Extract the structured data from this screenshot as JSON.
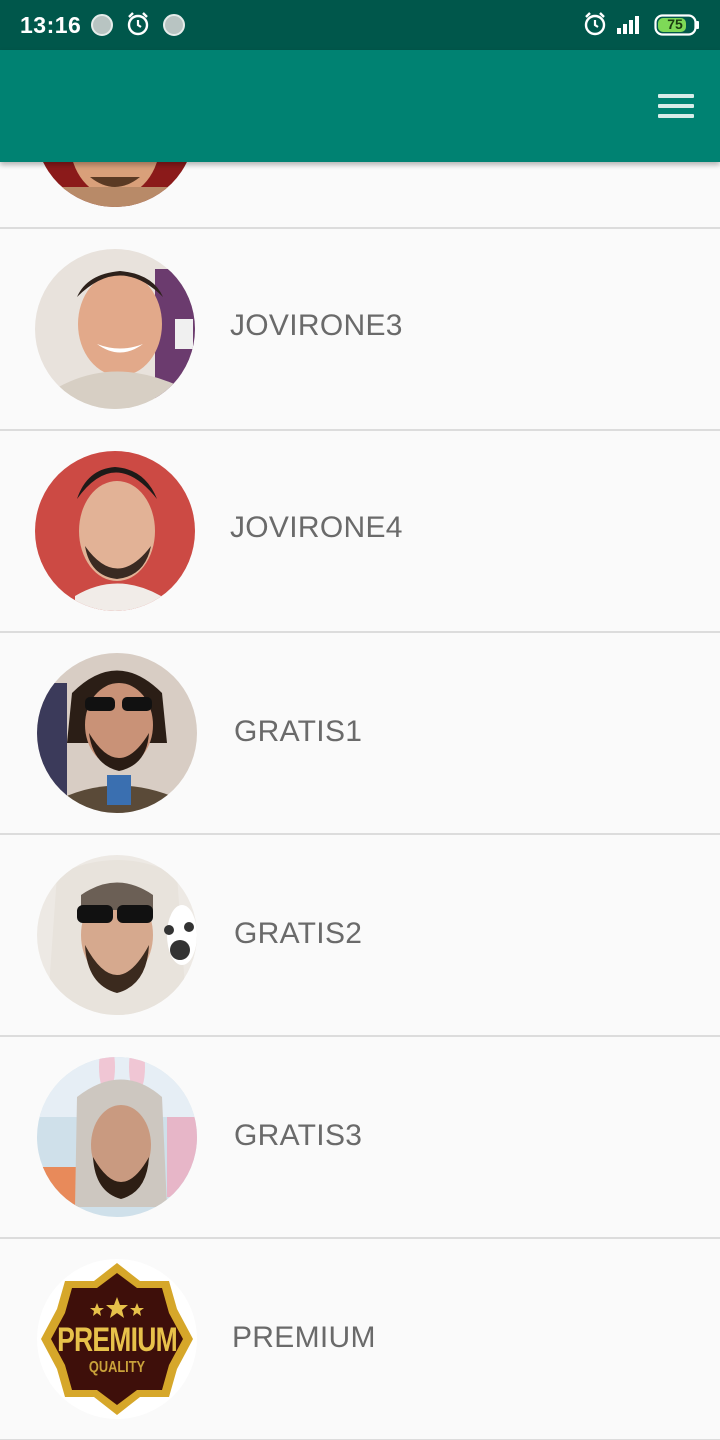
{
  "status_bar": {
    "time": "13:16",
    "battery_level": "75",
    "icons": [
      "notification-dot-icon",
      "alarm-icon",
      "notification-dot-icon",
      "alarm-icon",
      "signal-icon",
      "battery-icon"
    ]
  },
  "app_bar": {
    "background_color": "#008272",
    "menu_icon": "hamburger-menu-icon"
  },
  "list": {
    "items": [
      {
        "label": "",
        "avatar": "user-avatar"
      },
      {
        "label": "JOVIRONE3",
        "avatar": "user-avatar"
      },
      {
        "label": "JOVIRONE4",
        "avatar": "user-avatar"
      },
      {
        "label": "GRATIS1",
        "avatar": "user-avatar"
      },
      {
        "label": "GRATIS2",
        "avatar": "user-avatar"
      },
      {
        "label": "GRATIS3",
        "avatar": "user-avatar"
      },
      {
        "label": "PREMIUM",
        "avatar": "premium-badge"
      }
    ]
  },
  "premium_badge": {
    "title": "PREMIUM",
    "subtitle": "QUALITY"
  }
}
